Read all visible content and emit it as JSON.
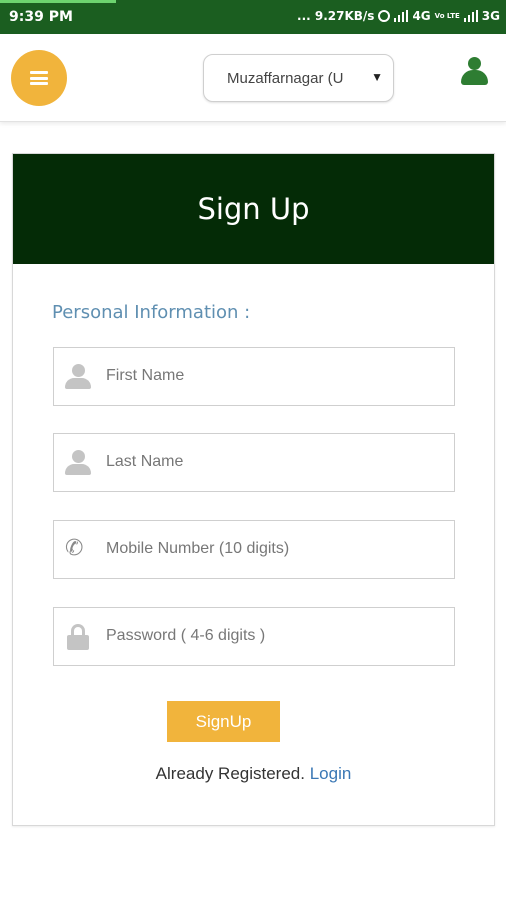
{
  "status_bar": {
    "time": "9:39 PM",
    "indicators": "... 9.27KB/s",
    "network_1": "4G",
    "volte": "Vo LTE",
    "network_2": "3G",
    "icons": [
      "alarm-icon",
      "signal-icon",
      "signal-icon"
    ]
  },
  "header": {
    "menu_icon": "hamburger-icon",
    "city": "Muzaffarnagar (U",
    "dropdown_arrow": "▼",
    "account_icon": "user-icon"
  },
  "form": {
    "title": "Sign Up",
    "section_label": "Personal Information :",
    "fields": [
      {
        "placeholder": "First Name",
        "icon": "person-icon"
      },
      {
        "placeholder": "Last Name",
        "icon": "person-icon"
      },
      {
        "placeholder": "Mobile Number (10 digits)",
        "icon": "phone-icon"
      },
      {
        "placeholder": "Password ( 4-6 digits )",
        "icon": "lock-icon"
      }
    ],
    "submit_label": "SignUp",
    "login_prompt": "Already Registered.",
    "login_link": "Login"
  },
  "colors": {
    "status_bar": "#1b5e20",
    "accent": "#f1b43c",
    "form_header": "#042b06",
    "section_label": "#5f8fb1",
    "link": "#3b78b5",
    "user_icon": "#2e7d32"
  }
}
